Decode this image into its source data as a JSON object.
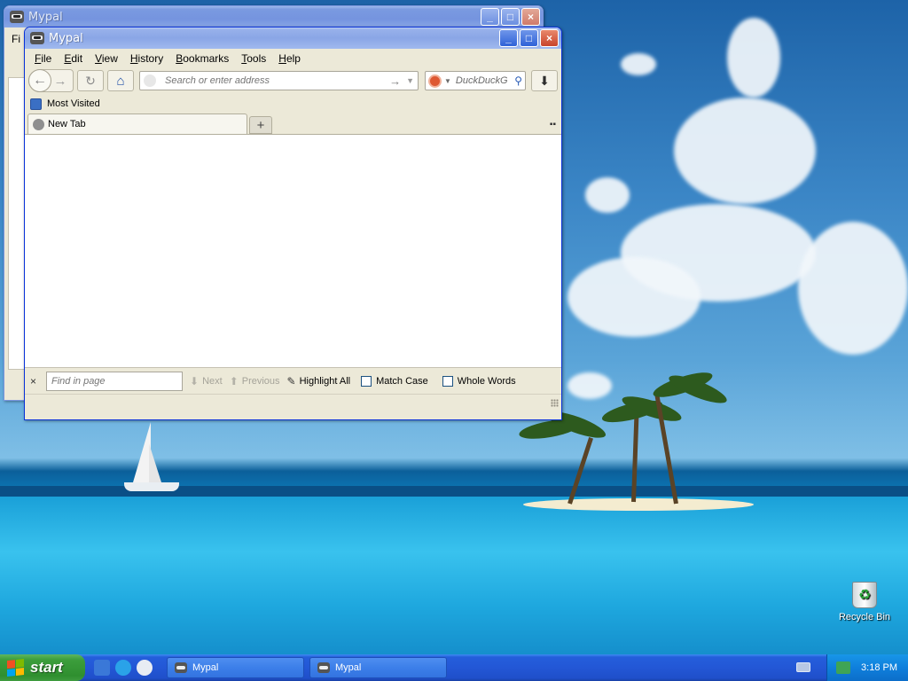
{
  "desktop": {
    "recycle_bin_label": "Recycle Bin"
  },
  "back_window": {
    "title": "Mypal",
    "menu_first": "Fi",
    "minimize": "_",
    "maximize": "□",
    "close": "×"
  },
  "window": {
    "title": "Mypal",
    "minimize": "_",
    "maximize": "□",
    "close": "×",
    "menu": [
      "File",
      "Edit",
      "View",
      "History",
      "Bookmarks",
      "Tools",
      "Help"
    ],
    "address_placeholder": "Search or enter address",
    "search_placeholder": "DuckDuckG",
    "bookmark": "Most Visited",
    "tab_label": "New Tab",
    "new_tab": "+",
    "tabs_list": "▪▪"
  },
  "findbar": {
    "close": "×",
    "placeholder": "Find in page",
    "next": "Next",
    "previous": "Previous",
    "highlight_all": "Highlight All",
    "match_case": "Match Case",
    "whole_words": "Whole Words"
  },
  "taskbar": {
    "start": "start",
    "tasks": [
      "Mypal",
      "Mypal"
    ],
    "clock": "3:18 PM"
  },
  "icons": {
    "back": "back-arrow-icon",
    "forward": "forward-arrow-icon",
    "reload": "reload-icon",
    "home": "home-icon",
    "download": "download-icon",
    "search": "search-icon"
  },
  "colors": {
    "xp_blue": "#245edb",
    "start_green": "#3c9e3c",
    "window_face": "#ece9d8"
  }
}
